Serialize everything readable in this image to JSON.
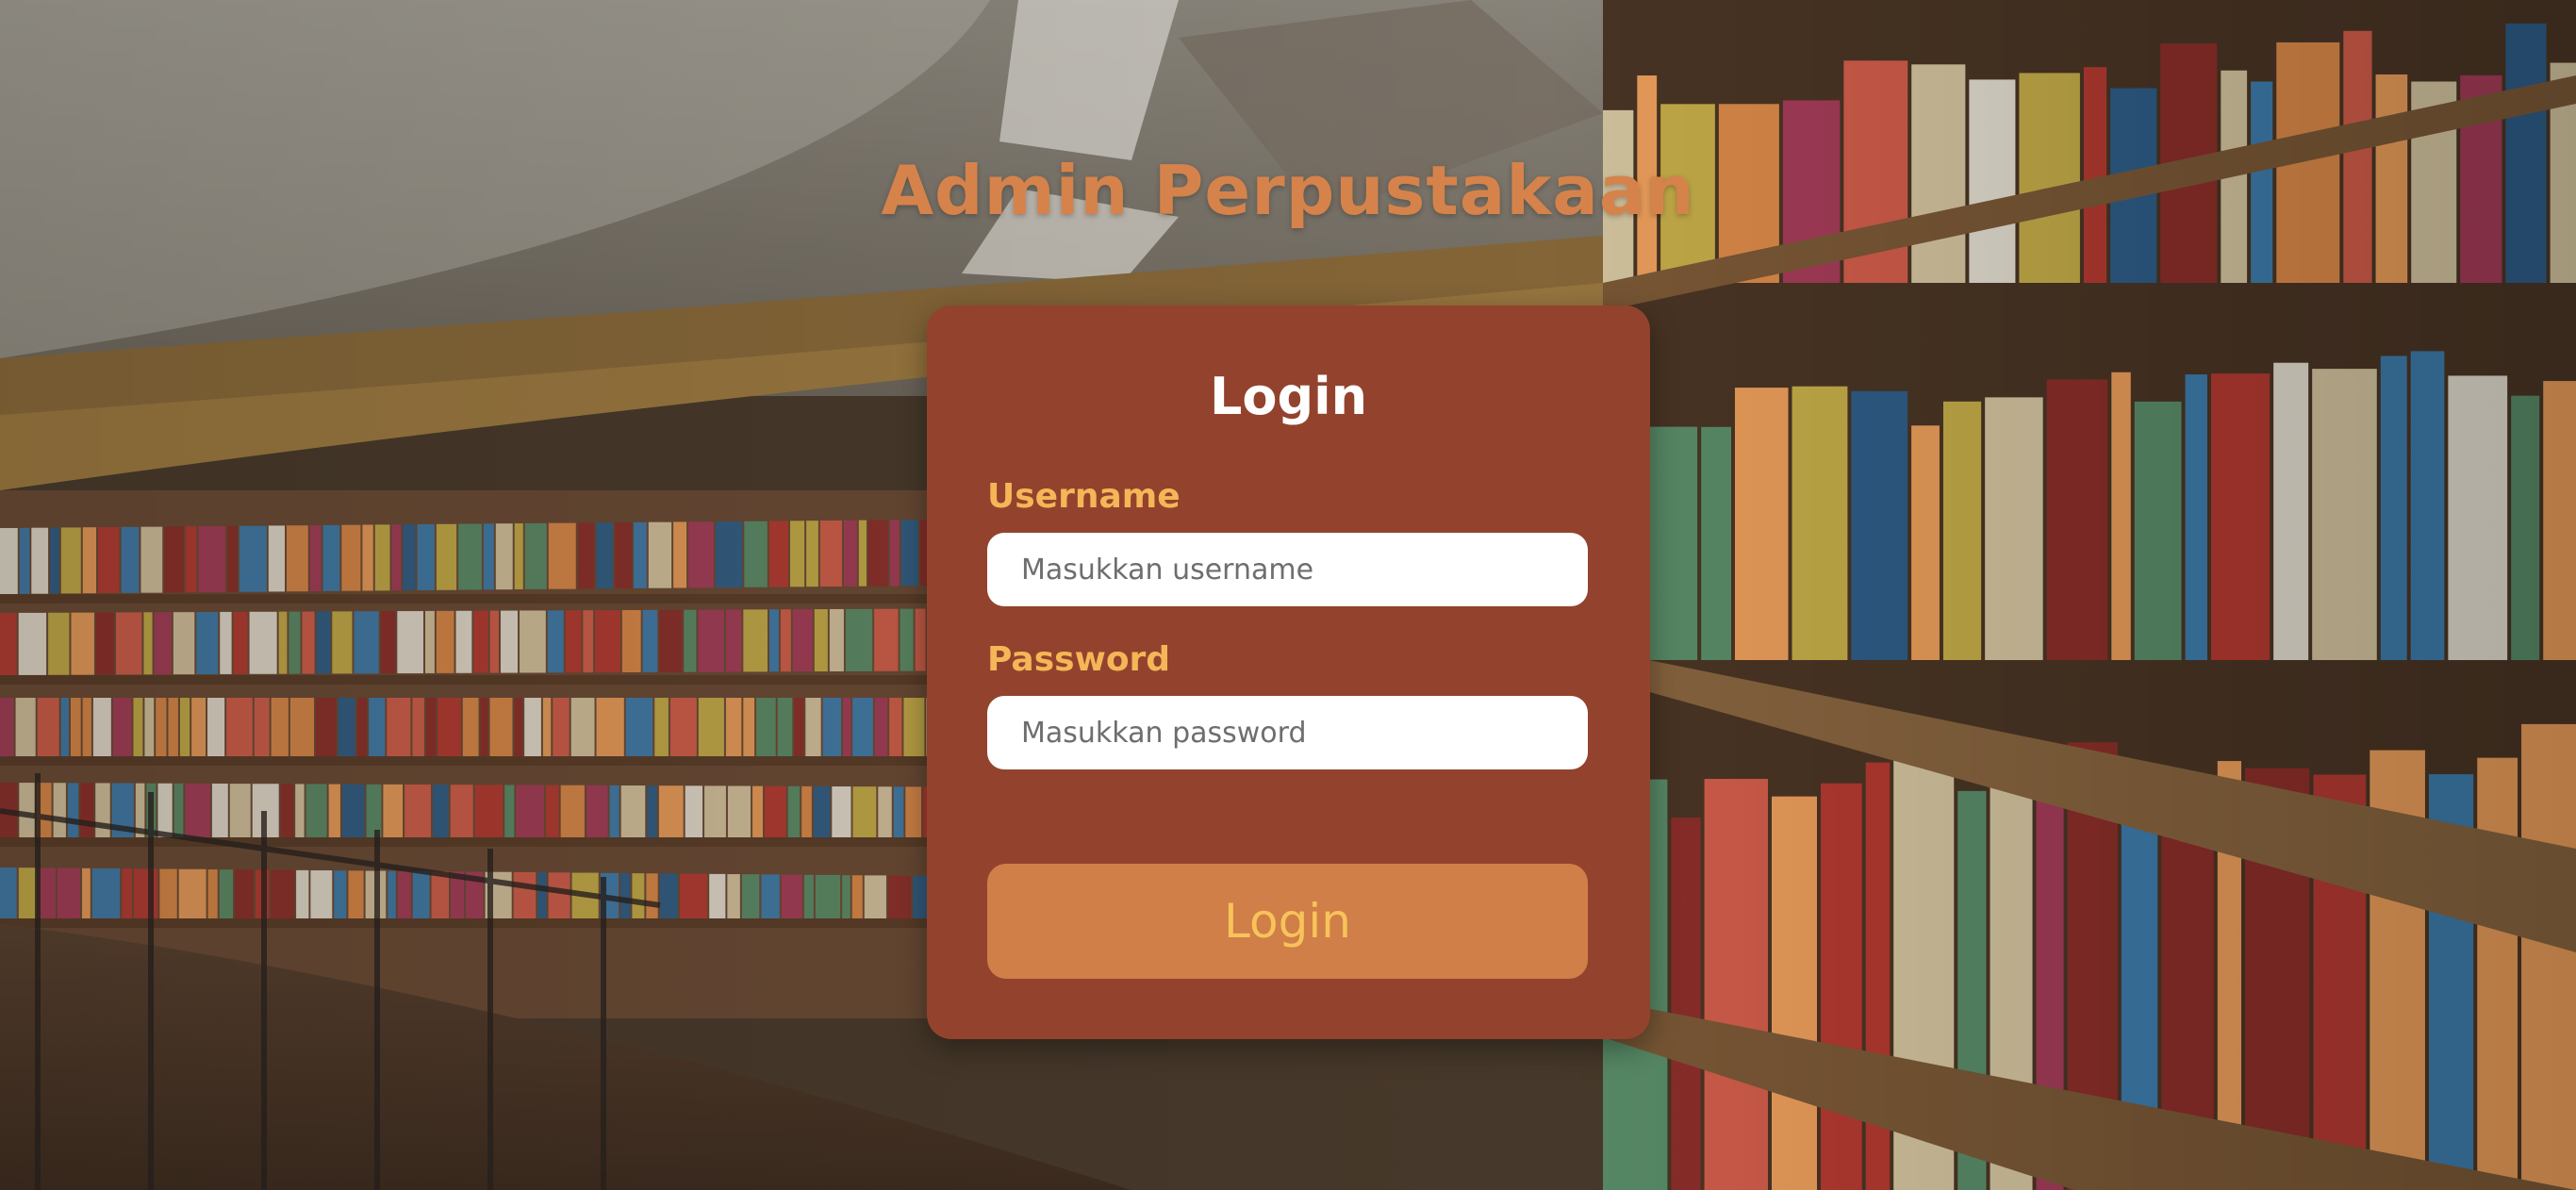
{
  "page": {
    "app_title": "Admin Perpustakaan"
  },
  "login_card": {
    "title": "Login",
    "username_label": "Username",
    "username_placeholder": "Masukkan username",
    "username_value": "",
    "password_label": "Password",
    "password_placeholder": "Masukkan password",
    "password_value": "",
    "button_label": "Login"
  },
  "colors": {
    "title_accent": "#d5834b",
    "card_background": "#93432d",
    "label_color": "#f5b657",
    "button_background": "#d07f48",
    "button_text": "#f7c35a"
  }
}
